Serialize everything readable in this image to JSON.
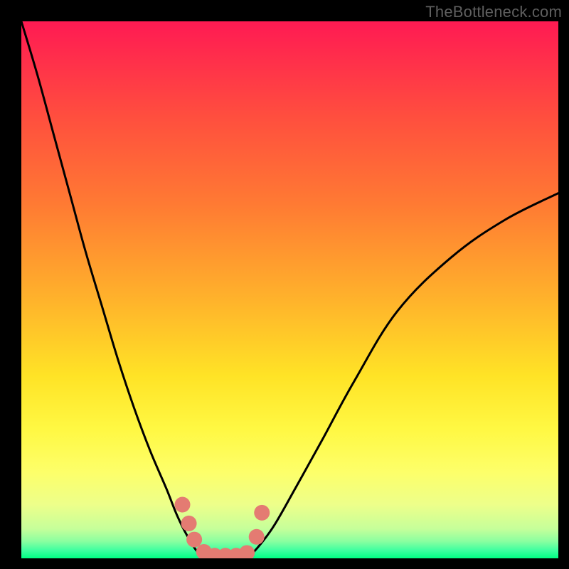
{
  "watermark": "TheBottleneck.com",
  "chart_data": {
    "type": "line",
    "title": "",
    "xlabel": "",
    "ylabel": "",
    "xlim": [
      0,
      100
    ],
    "ylim": [
      0,
      100
    ],
    "gradient_bands": [
      {
        "color": "#ff1a53",
        "stop": 0.0,
        "note": "top red/magenta"
      },
      {
        "color": "#ff4f3e",
        "stop": 0.18
      },
      {
        "color": "#ff7a33",
        "stop": 0.34
      },
      {
        "color": "#ffb32b",
        "stop": 0.52
      },
      {
        "color": "#ffe326",
        "stop": 0.66
      },
      {
        "color": "#fff843",
        "stop": 0.76
      },
      {
        "color": "#fdff6a",
        "stop": 0.84
      },
      {
        "color": "#edff8a",
        "stop": 0.9
      },
      {
        "color": "#c6ff9a",
        "stop": 0.945
      },
      {
        "color": "#8bffa0",
        "stop": 0.968
      },
      {
        "color": "#3fffa0",
        "stop": 0.985
      },
      {
        "color": "#00ff84",
        "stop": 1.0,
        "note": "bottom green"
      }
    ],
    "series": [
      {
        "name": "left-curve",
        "x": [
          0,
          3,
          6,
          9,
          12,
          15,
          18,
          21,
          24,
          27,
          29,
          31,
          33,
          35
        ],
        "y": [
          100,
          90,
          79,
          68,
          57,
          47,
          37,
          28,
          20,
          13,
          8,
          4,
          1,
          0
        ],
        "note": "steep falloff approaching valley from top-left; y is % height above bottom"
      },
      {
        "name": "right-curve",
        "x": [
          42,
          44,
          47,
          51,
          56,
          62,
          70,
          80,
          90,
          100
        ],
        "y": [
          0,
          2,
          6,
          13,
          22,
          33,
          46,
          56,
          63,
          68
        ],
        "note": "rising curve toward upper-right, shallower than left side"
      },
      {
        "name": "valley-floor",
        "x": [
          35,
          36,
          37,
          38,
          39,
          40,
          41,
          42
        ],
        "y": [
          0,
          0,
          0,
          0,
          0,
          0,
          0,
          0
        ],
        "note": "flat bottom between the two curves"
      }
    ],
    "markers": {
      "name": "salmon-dots",
      "color": "#e47b72",
      "radius_px": 11,
      "points": [
        {
          "x": 30.0,
          "y": 10.0
        },
        {
          "x": 31.2,
          "y": 6.5
        },
        {
          "x": 32.2,
          "y": 3.5
        },
        {
          "x": 34.0,
          "y": 1.2
        },
        {
          "x": 36.0,
          "y": 0.5
        },
        {
          "x": 38.0,
          "y": 0.5
        },
        {
          "x": 40.0,
          "y": 0.5
        },
        {
          "x": 42.0,
          "y": 1.0
        },
        {
          "x": 43.8,
          "y": 4.0
        },
        {
          "x": 44.8,
          "y": 8.5
        }
      ],
      "note": "cluster of ~10 salmon circles lining the valley; x,y in same % coords as series"
    }
  }
}
